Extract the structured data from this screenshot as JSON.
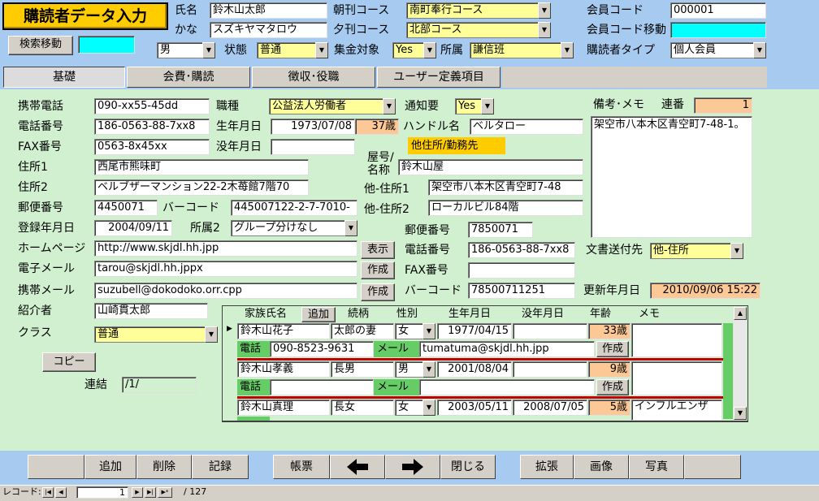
{
  "header": {
    "title": "購読者データ入力",
    "name_label": "氏名",
    "name": "鈴木山太郎",
    "kana_label": "かな",
    "kana": "スズキヤマタロウ",
    "morning_label": "朝刊コース",
    "morning": "南町奉行コース",
    "evening_label": "夕刊コース",
    "evening": "北部コース",
    "member_code_label": "会員コード",
    "member_code": "000001",
    "member_move_label": "会員コード移動",
    "member_move": "",
    "search_move": "検索移動",
    "search_move_value": "",
    "gender": "男",
    "state_label": "状態",
    "state": "普通",
    "collect_label": "集金対象",
    "collect": "Yes",
    "belong_label": "所属",
    "belong": "謙信班",
    "type_label": "購読者タイプ",
    "type": "個人会員"
  },
  "tabs": [
    "基礎",
    "会費･購読",
    "徴収･役職",
    "ユーザー定義項目"
  ],
  "form": {
    "mobile_label": "携帯電話",
    "mobile": "090-xx55-45dd",
    "job_label": "職種",
    "job": "公益法人労働者",
    "notify_label": "通知要",
    "notify": "Yes",
    "memo_label": "備考･メモ",
    "serial_label": "連番",
    "serial": "1",
    "memo": "架空市八本木区青空町7-48-1。",
    "phone_label": "電話番号",
    "phone": "186-0563-88-7xx8",
    "birth_label": "生年月日",
    "birth": "1973/07/08",
    "age": "37歳",
    "handle_label": "ハンドル名",
    "handle": "ベルタロー",
    "fax_label": "FAX番号",
    "fax": "0563-8x45xx",
    "death_label": "没年月日",
    "death": "",
    "other_address_badge": "他住所/勤務先",
    "shop_label1": "屋号/",
    "shop_label2": "名称",
    "shop": "鈴木山屋",
    "address1_label": "住所1",
    "address1": "西尾市熊味町",
    "other_address1_label": "他-住所1",
    "other_address1": "架空市八本木区青空町7-48",
    "address2_label": "住所2",
    "address2": "ベルブザーマンション22-2木苺館7階70",
    "other_address2_label": "他-住所2",
    "other_address2": "ローカルビル84階",
    "zip_label": "郵便番号",
    "zip": "4450071",
    "barcode_label": "バーコード",
    "barcode": "445007122-2-7-7010-",
    "other_zip_label": "郵便番号",
    "other_zip": "7850071",
    "reg_label": "登録年月日",
    "reg": "2004/09/11",
    "belong2_label": "所属2",
    "belong2": "グループ分けなし",
    "hp_label": "ホームページ",
    "hp": "http://www.skjdl.hh.jpp",
    "show_button": "表示",
    "other_phone_label": "電話番号",
    "other_phone": "186-0563-88-7xx8",
    "send_to_label": "文書送付先",
    "send_to": "他-住所",
    "email_label": "電子メール",
    "email": "tarou@skjdl.hh.jppx",
    "create_button": "作成",
    "other_fax_label": "FAX番号",
    "other_fax": "",
    "mobile_mail_label": "携帯メール",
    "mobile_mail": "suzubell@dokodoko.orr.cpp",
    "create_button2": "作成",
    "other_barcode_label": "バーコード",
    "other_barcode": "78500711251",
    "updated_label": "更新年月日",
    "updated": "2010/09/06 15:22",
    "introducer_label": "紹介者",
    "introducer": "山崎貫太郎",
    "class_label": "クラス",
    "class": "普通",
    "copy_button": "コピー",
    "link_label": "連結",
    "link": "/1/"
  },
  "family": {
    "headers": {
      "name": "家族氏名",
      "add": "追加",
      "relation": "続柄",
      "gender": "性別",
      "birth": "生年月日",
      "death": "没年月日",
      "age": "年齢",
      "memo": "メモ"
    },
    "phone_label": "電話",
    "mail_label": "メール",
    "create_label": "作成",
    "rows": [
      {
        "name": "鈴木山花子",
        "relation": "太郎の妻",
        "gender": "女",
        "birth": "1977/04/15",
        "death": "",
        "age": "33歳",
        "memo": "",
        "phone": "090-8523-9631",
        "mail": "tumatuma@skjdl.hh.jpp"
      },
      {
        "name": "鈴木山孝義",
        "relation": "長男",
        "gender": "男",
        "birth": "2001/08/04",
        "death": "",
        "age": "9歳",
        "memo": "",
        "phone": "",
        "mail": ""
      },
      {
        "name": "鈴木山真理",
        "relation": "長女",
        "gender": "女",
        "birth": "2003/05/11",
        "death": "2008/07/05",
        "age": "5歳",
        "memo": "インフルエンザ",
        "phone": "",
        "mail": ""
      }
    ]
  },
  "toolbar": {
    "add": "追加",
    "delete": "削除",
    "save": "記録",
    "ledger": "帳票",
    "prev_icon": "arrow-left-icon",
    "next_icon": "arrow-right-icon",
    "close": "閉じる",
    "expand": "拡張",
    "image": "画像",
    "photo": "写真"
  },
  "status": {
    "record_label": "レコード:",
    "current": "1",
    "total": "/ 127"
  }
}
